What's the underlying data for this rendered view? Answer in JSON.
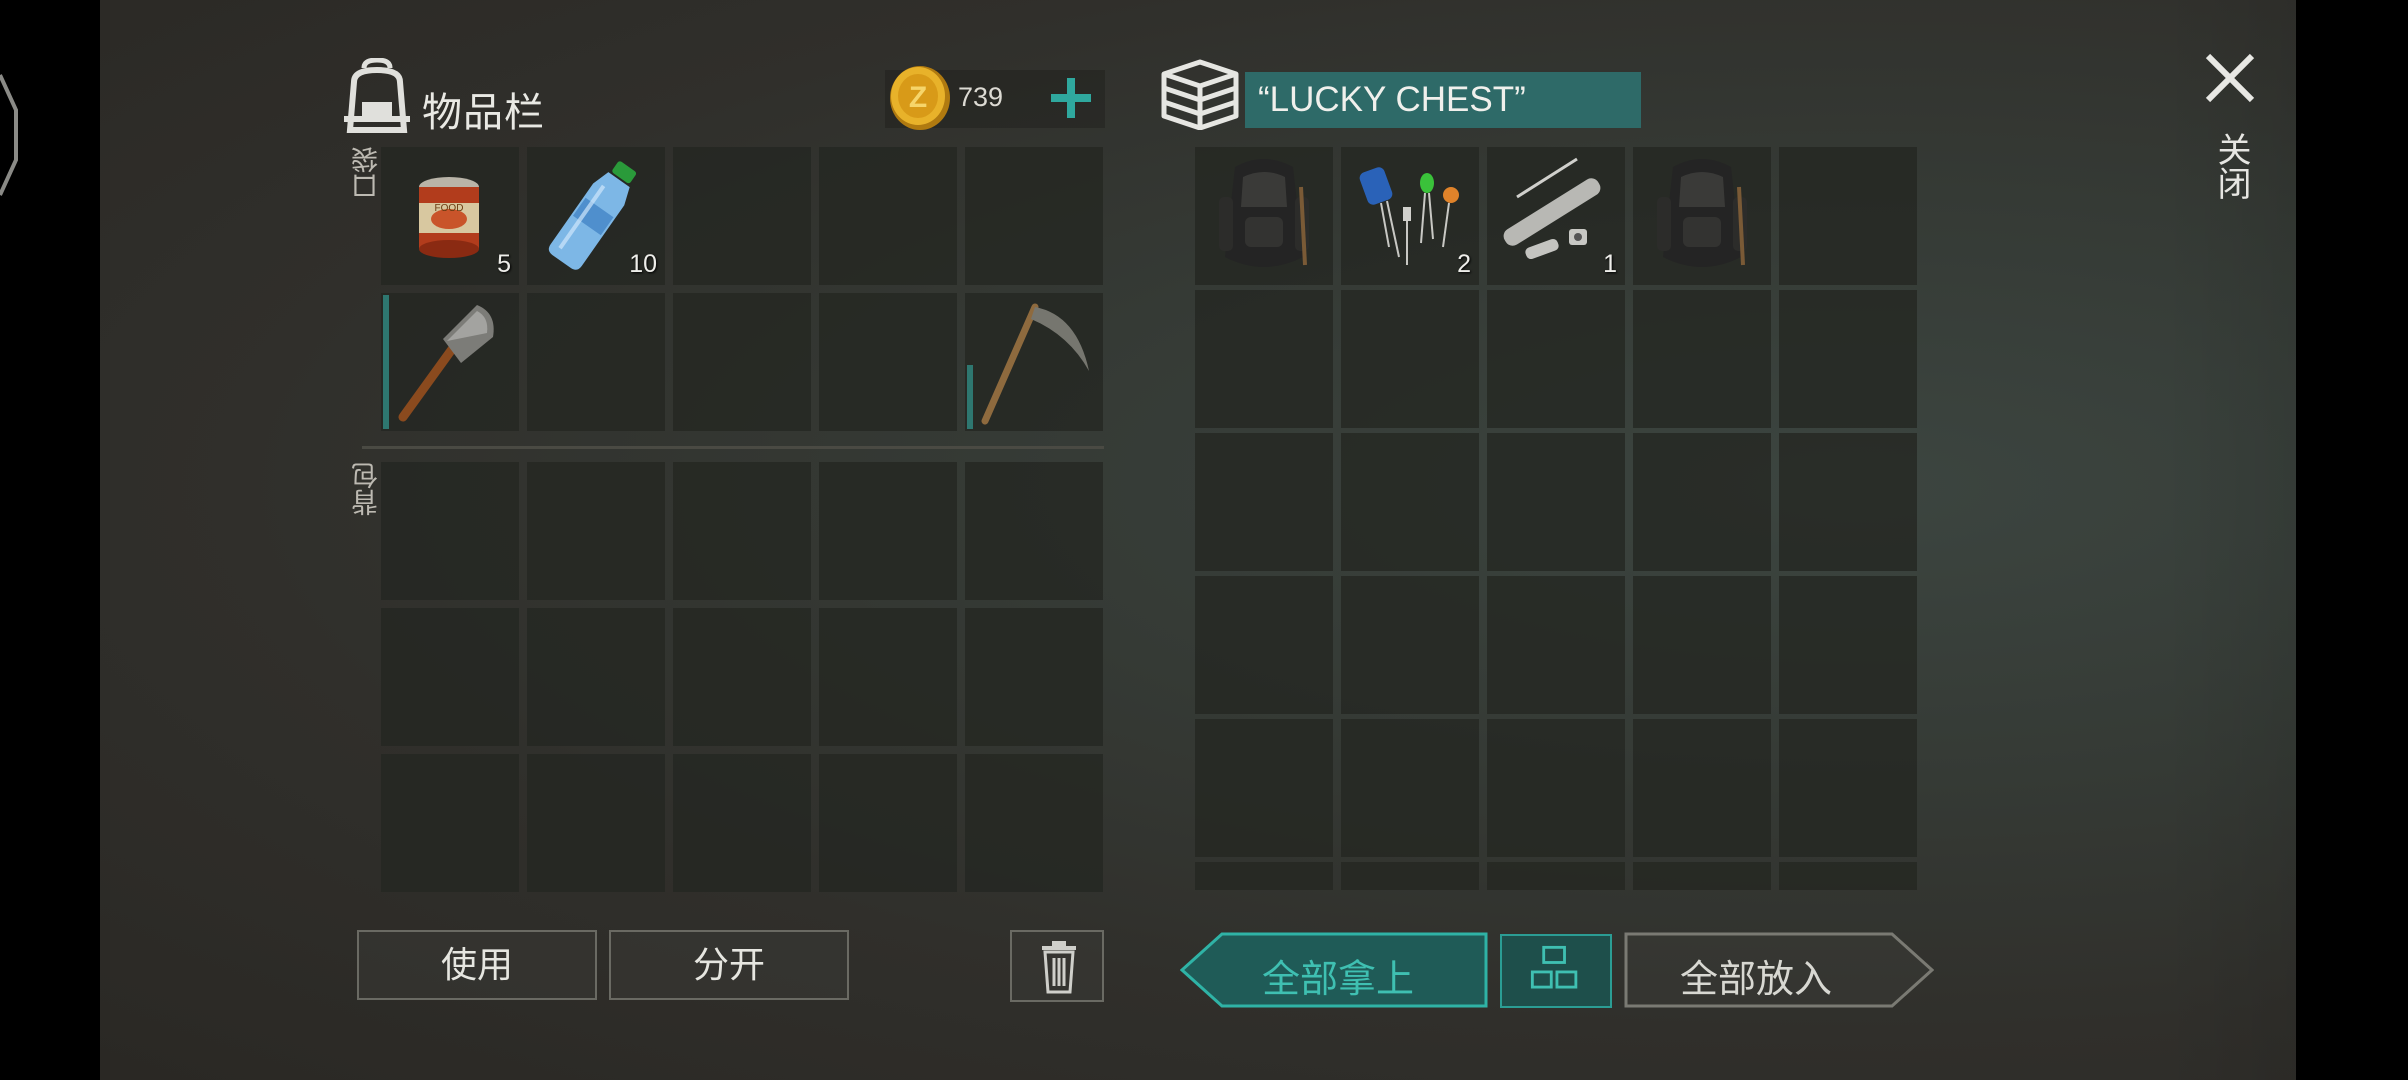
{
  "inventory": {
    "title": "物品栏",
    "coins": "739",
    "pockets_label": "口袋",
    "backpack_label": "背包",
    "pockets": [
      {
        "item": "canned-food",
        "qty": "5"
      },
      {
        "item": "water-bottle",
        "qty": "10"
      },
      {
        "item": "",
        "qty": ""
      },
      {
        "item": "",
        "qty": ""
      },
      {
        "item": "",
        "qty": ""
      },
      {
        "item": "shovel",
        "qty": "",
        "durability": 0.95
      },
      {
        "item": "",
        "qty": ""
      },
      {
        "item": "",
        "qty": ""
      },
      {
        "item": "",
        "qty": ""
      },
      {
        "item": "scythe",
        "qty": "",
        "durability": 0.45
      }
    ],
    "backpack_slots": 15
  },
  "chest": {
    "name": "“LUCKY CHEST”",
    "items": [
      {
        "item": "backpack",
        "qty": ""
      },
      {
        "item": "electronic-parts",
        "qty": "2"
      },
      {
        "item": "pipe-parts",
        "qty": "1"
      },
      {
        "item": "backpack",
        "qty": ""
      },
      {
        "item": "",
        "qty": ""
      }
    ],
    "rows": 6,
    "cols": 5
  },
  "buttons": {
    "use": "使用",
    "split": "分开",
    "take_all": "全部拿上",
    "put_all": "全部放入",
    "close": "关闭"
  },
  "colors": {
    "accent_teal": "#2e6a68",
    "take_all_text": "#3fc0b2",
    "coin_gold": "#e0a81e"
  }
}
